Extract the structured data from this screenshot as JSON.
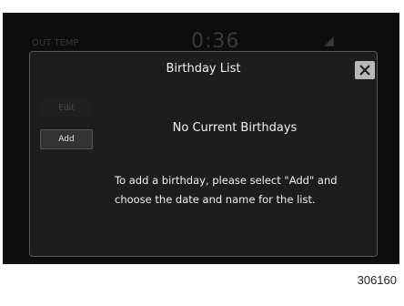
{
  "status_bar": {
    "left_text": "OUT TEMP",
    "time": "0:36"
  },
  "dialog": {
    "title": "Birthday List",
    "edit_label": "Edit",
    "add_label": "Add",
    "empty_message": "No Current Birthdays",
    "help_text_line1": "To add a birthday, please select \"Add\" and",
    "help_text_line2": "choose the date and name for the list."
  },
  "figure_number": "306160",
  "icons": {
    "close": "close-icon",
    "status_right": "signal-icon"
  }
}
